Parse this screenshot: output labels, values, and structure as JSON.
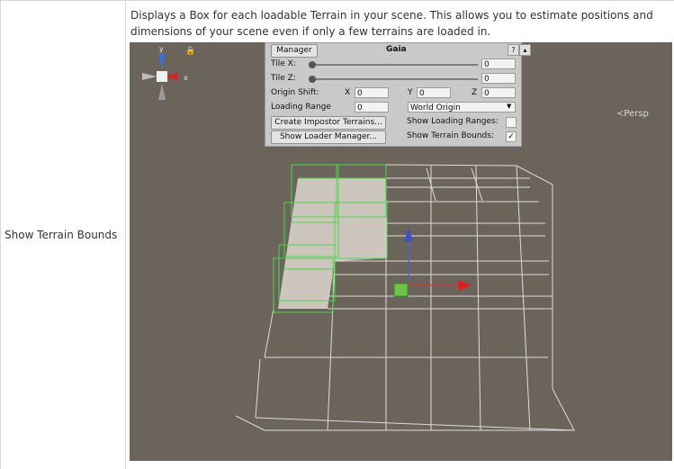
{
  "table": {
    "row_label": "Show Terrain Bounds",
    "description": "Displays a Box for each loadable Terrain in your scene. This allows you to estimate positions and dimensions of your scene even if only a few terrains are loaded in."
  },
  "panel": {
    "tab_label": "Manager",
    "title": "Gaia",
    "help_icon": "?",
    "menu_icon": "▴",
    "tile_x_label": "Tile X:",
    "tile_x_value": "0",
    "tile_z_label": "Tile Z:",
    "tile_z_value": "0",
    "origin_shift_label": "Origin Shift:",
    "origin_x_label": "X",
    "origin_x_value": "0",
    "origin_y_label": "Y",
    "origin_y_value": "0",
    "origin_z_label": "Z",
    "origin_z_value": "0",
    "loading_range_label": "Loading Range",
    "loading_range_value": "0",
    "origin_mode_value": "World Origin",
    "create_impostor_label": "Create Impostor Terrains...",
    "show_loading_ranges_label": "Show Loading Ranges:",
    "show_loading_ranges_checked": false,
    "show_loader_manager_label": "Show Loader Manager...",
    "show_terrain_bounds_label": "Show Terrain Bounds:",
    "show_terrain_bounds_check": "✓"
  },
  "gizmo": {
    "y_label": "y",
    "x_label": "x",
    "persp_label": "≺Persp"
  },
  "colors": {
    "scene_bg": "#6b645b",
    "bounds_green": "#4cd64c",
    "bounds_white": "#dcdcdc",
    "terrain": "#cdc6bd"
  }
}
